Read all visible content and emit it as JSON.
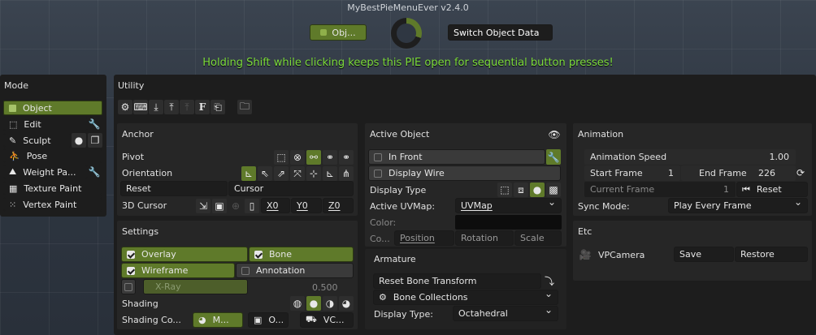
{
  "app_title": "MyBestPieMenuEver v2.4.0",
  "top": {
    "obj_button": "Obj...",
    "switch_button": "Switch Object Data",
    "hint": "Holding Shift while clicking keeps this PIE open for sequential button presses!"
  },
  "mode": {
    "title": "Mode",
    "items": [
      {
        "label": "Object",
        "icon": "object-mode-icon"
      },
      {
        "label": "Edit",
        "icon": "edit-mode-icon"
      },
      {
        "label": "Sculpt",
        "icon": "sculpt-mode-icon"
      },
      {
        "label": "Pose",
        "icon": "pose-mode-icon"
      },
      {
        "label": "Weight Pa...",
        "icon": "weight-paint-icon"
      },
      {
        "label": "Texture Paint",
        "icon": "texture-paint-icon"
      },
      {
        "label": "Vertex Paint",
        "icon": "vertex-paint-icon"
      }
    ]
  },
  "utility": {
    "title": "Utility"
  },
  "anchor": {
    "title": "Anchor",
    "pivot": "Pivot",
    "orientation": "Orientation",
    "reset": "Reset",
    "cursor": "Cursor",
    "cursor_3d": "3D Cursor",
    "x0": "X0",
    "y0": "Y0",
    "z0": "Z0"
  },
  "settings": {
    "title": "Settings",
    "overlay": "Overlay",
    "bone": "Bone",
    "wireframe": "Wireframe",
    "annotation": "Annotation",
    "xray": "X-Ray",
    "xray_value": "0.500",
    "shading": "Shading",
    "shading_color": "Shading Co...",
    "shade_m": "M...",
    "shade_o": "O...",
    "shade_vc": "VC..."
  },
  "active_object": {
    "title": "Active Object",
    "in_front": "In Front",
    "display_wire": "Display Wire",
    "display_type": "Display Type",
    "active_uvmap": "Active UVMap:",
    "uvmap_value": "UVMap",
    "color": "Color:",
    "tabs": [
      "Co...",
      "Position",
      "Rotation",
      "Scale"
    ]
  },
  "armature": {
    "title": "Armature",
    "reset_bone": "Reset Bone Transform",
    "bone_collections": "Bone Collections",
    "display_type": "Display Type:",
    "display_value": "Octahedral"
  },
  "animation": {
    "title": "Animation",
    "speed_label": "Animation Speed",
    "speed_value": "1.00",
    "start_label": "Start Frame",
    "start_value": "1",
    "end_label": "End Frame",
    "end_value": "226",
    "current_label": "Current Frame",
    "current_value": "1",
    "reset": "Reset",
    "sync_label": "Sync Mode:",
    "sync_value": "Play Every Frame"
  },
  "etc": {
    "title": "Etc",
    "camera": "VPCamera",
    "save": "Save",
    "restore": "Restore"
  },
  "colors": {
    "accent_green": "#5f7a2a",
    "hint_green": "#7ddc3c",
    "panel": "#1d1d1d"
  }
}
